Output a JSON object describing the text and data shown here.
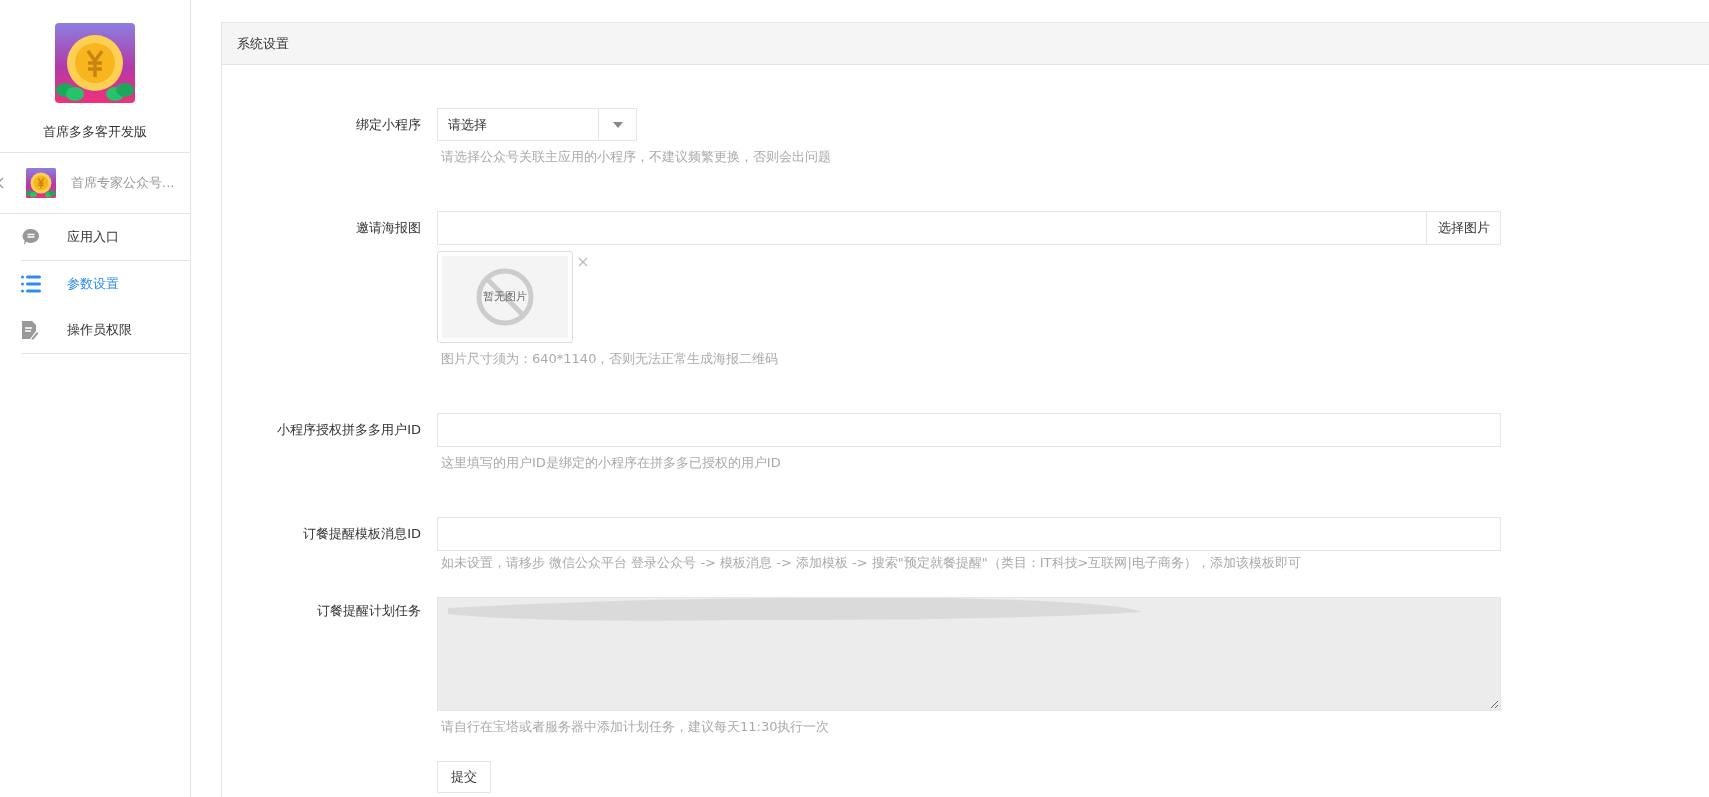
{
  "sidebar": {
    "app_name": "首席多多客开发版",
    "account": {
      "name": "首席专家公众号..."
    },
    "items": [
      {
        "label": "应用入口",
        "kind": "chat",
        "selected": false
      },
      {
        "label": "参数设置",
        "kind": "list",
        "selected": true
      },
      {
        "label": "操作员权限",
        "kind": "doc",
        "selected": false
      }
    ]
  },
  "panel": {
    "title": "系统设置",
    "fields": [
      {
        "kind": "select",
        "label": "绑定小程序",
        "value": "请选择",
        "help": "请选择公众号关联主应用的小程序，不建议频繁更换，否则会出问题"
      },
      {
        "kind": "image",
        "label": "邀请海报图",
        "button": "选择图片",
        "preview_text": "暂无图片",
        "help": "图片尺寸须为：640*1140，否则无法正常生成海报二维码"
      },
      {
        "kind": "input",
        "label": "小程序授权拼多多用户ID",
        "help": "这里填写的用户ID是绑定的小程序在拼多多已授权的用户ID"
      },
      {
        "kind": "input",
        "label": "订餐提醒模板消息ID",
        "help": "如未设置，请移步 微信公众平台 登录公众号 -> 模板消息 -> 添加模板 -> 搜索\"预定就餐提醒\"（类目：IT科技>互联网|电子商务），添加该模板即可"
      },
      {
        "kind": "textarea",
        "label": "订餐提醒计划任务",
        "readonly": true,
        "redacted": true,
        "help": "请自行在宝塔或者服务器中添加计划任务，建议每天11:30执行一次"
      }
    ],
    "submit": "提交"
  }
}
